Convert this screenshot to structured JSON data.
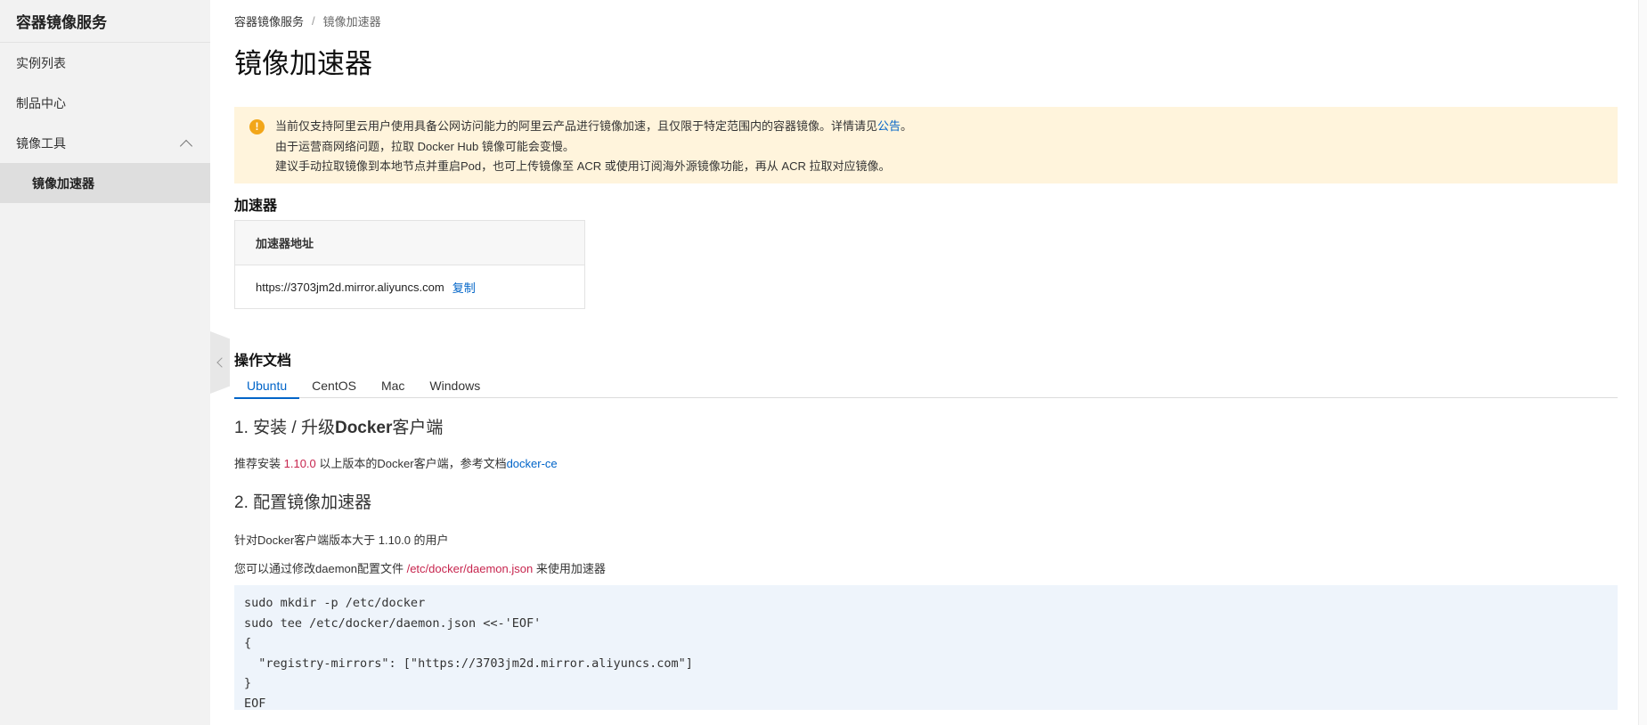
{
  "sidebar": {
    "title": "容器镜像服务",
    "items": [
      {
        "label": "实例列表"
      },
      {
        "label": "制品中心"
      },
      {
        "label": "镜像工具"
      },
      {
        "label": "镜像加速器"
      }
    ]
  },
  "breadcrumb": {
    "parent": "容器镜像服务",
    "separator": "/",
    "current": "镜像加速器"
  },
  "page_title": "镜像加速器",
  "alert": {
    "line1_text": "当前仅支持阿里云用户使用具备公网访问能力的阿里云产品进行镜像加速，且仅限于特定范围内的容器镜像。详情请见",
    "line1_link": "公告",
    "line1_end": "。",
    "line2": "由于运营商网络问题，拉取 Docker Hub 镜像可能会变慢。",
    "line3": "建议手动拉取镜像到本地节点并重启Pod，也可上传镜像至 ACR 或使用订阅海外源镜像功能，再从 ACR 拉取对应镜像。"
  },
  "accelerator": {
    "section_title": "加速器",
    "column_header": "加速器地址",
    "address": "https://3703jm2d.mirror.aliyuncs.com",
    "copy_label": "复制"
  },
  "docs": {
    "section_title": "操作文档",
    "tabs": [
      {
        "label": "Ubuntu"
      },
      {
        "label": "CentOS"
      },
      {
        "label": "Mac"
      },
      {
        "label": "Windows"
      }
    ],
    "step1": {
      "prefix": "1. 安装 / 升级",
      "bold": "Docker",
      "suffix": "客户端",
      "text_before": "推荐安装 ",
      "version": "1.10.0",
      "text_after": " 以上版本的Docker客户端，参考文档",
      "link": "docker-ce"
    },
    "step2": {
      "title": "2. 配置镜像加速器",
      "p1": "针对Docker客户端版本大于 1.10.0 的用户",
      "p2_before": "您可以通过修改daemon配置文件 ",
      "p2_path": "/etc/docker/daemon.json",
      "p2_after": " 来使用加速器",
      "code": "sudo mkdir -p /etc/docker\nsudo tee /etc/docker/daemon.json <<-'EOF'\n{\n  \"registry-mirrors\": [\"https://3703jm2d.mirror.aliyuncs.com\"]\n}\nEOF"
    }
  }
}
